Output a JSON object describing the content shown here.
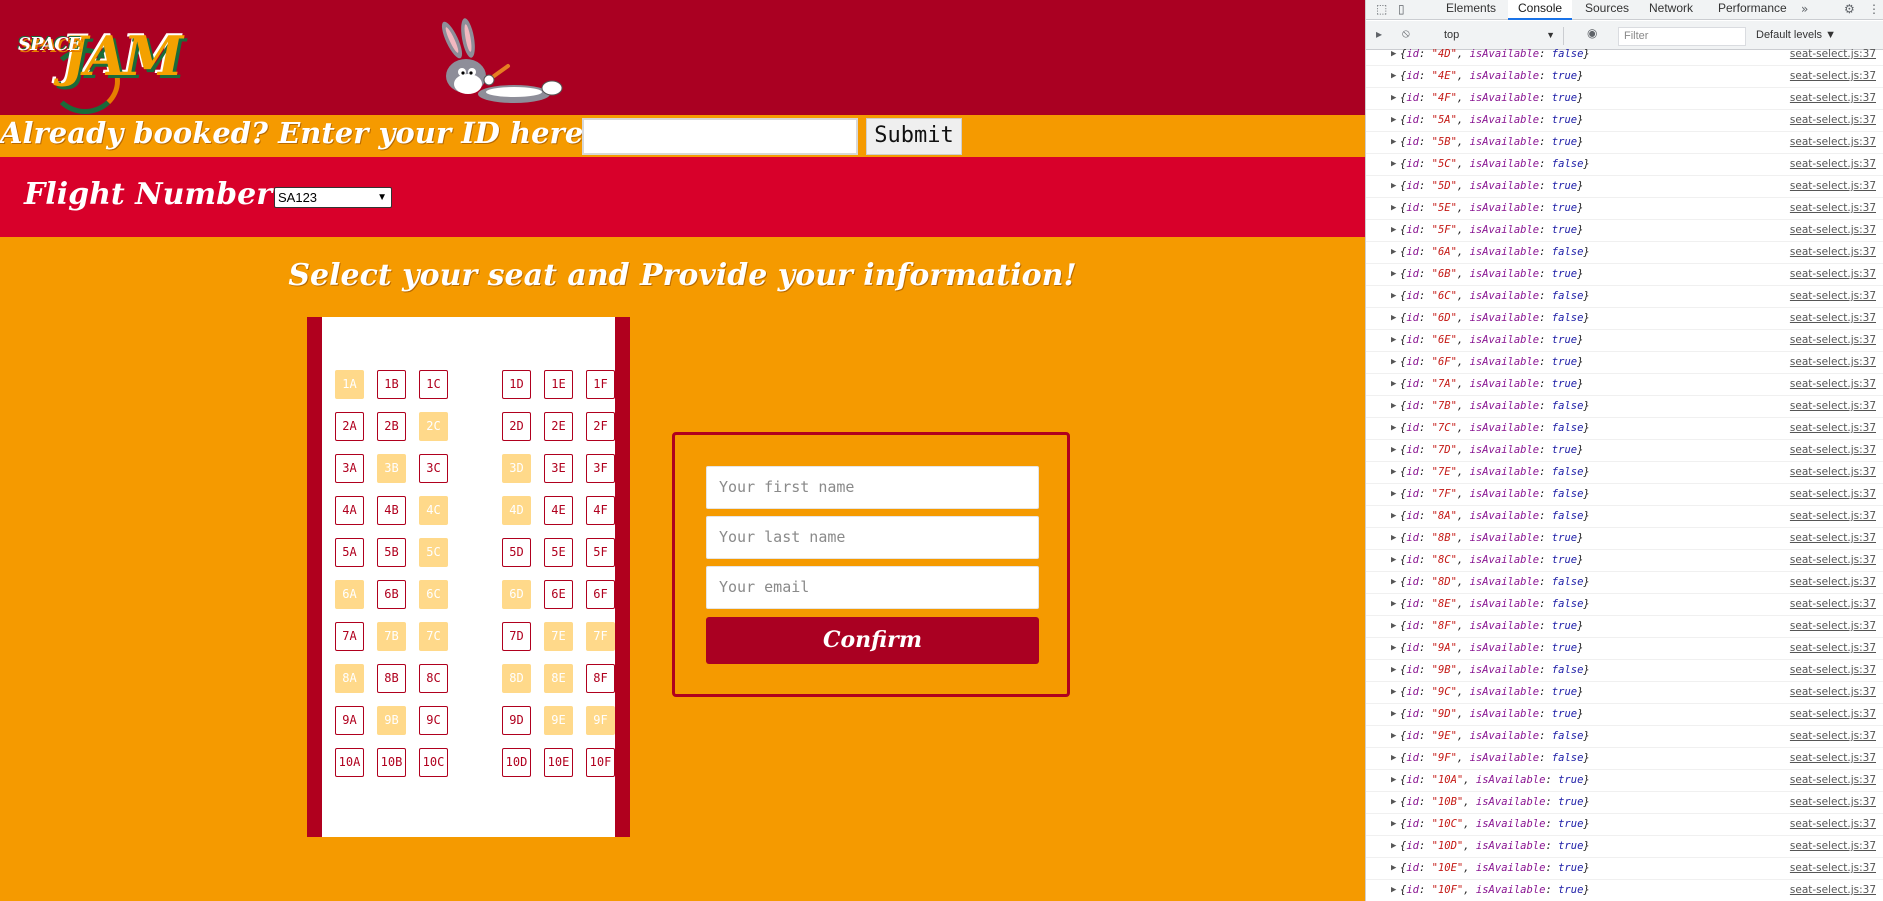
{
  "app": {
    "logo_text_space": "SPACE",
    "logo_text_jam": "JAM",
    "booked_label": "Already booked? Enter your ID here!",
    "booked_input_value": "",
    "submit_label": "Submit",
    "flight_label": "Flight Number :",
    "flight_selected": "SA123",
    "title": "Select your seat and Provide your information!",
    "seats_left": [
      [
        {
          "id": "1A",
          "taken": true
        },
        {
          "id": "1B",
          "taken": false
        },
        {
          "id": "1C",
          "taken": false
        }
      ],
      [
        {
          "id": "2A",
          "taken": false
        },
        {
          "id": "2B",
          "taken": false
        },
        {
          "id": "2C",
          "taken": true
        }
      ],
      [
        {
          "id": "3A",
          "taken": false
        },
        {
          "id": "3B",
          "taken": true
        },
        {
          "id": "3C",
          "taken": false
        }
      ],
      [
        {
          "id": "4A",
          "taken": false
        },
        {
          "id": "4B",
          "taken": false
        },
        {
          "id": "4C",
          "taken": true
        }
      ],
      [
        {
          "id": "5A",
          "taken": false
        },
        {
          "id": "5B",
          "taken": false
        },
        {
          "id": "5C",
          "taken": true
        }
      ],
      [
        {
          "id": "6A",
          "taken": true
        },
        {
          "id": "6B",
          "taken": false
        },
        {
          "id": "6C",
          "taken": true
        }
      ],
      [
        {
          "id": "7A",
          "taken": false
        },
        {
          "id": "7B",
          "taken": true
        },
        {
          "id": "7C",
          "taken": true
        }
      ],
      [
        {
          "id": "8A",
          "taken": true
        },
        {
          "id": "8B",
          "taken": false
        },
        {
          "id": "8C",
          "taken": false
        }
      ],
      [
        {
          "id": "9A",
          "taken": false
        },
        {
          "id": "9B",
          "taken": true
        },
        {
          "id": "9C",
          "taken": false
        }
      ],
      [
        {
          "id": "10A",
          "taken": false
        },
        {
          "id": "10B",
          "taken": false
        },
        {
          "id": "10C",
          "taken": false
        }
      ]
    ],
    "seats_right": [
      [
        {
          "id": "1D",
          "taken": false
        },
        {
          "id": "1E",
          "taken": false
        },
        {
          "id": "1F",
          "taken": false
        }
      ],
      [
        {
          "id": "2D",
          "taken": false
        },
        {
          "id": "2E",
          "taken": false
        },
        {
          "id": "2F",
          "taken": false
        }
      ],
      [
        {
          "id": "3D",
          "taken": true
        },
        {
          "id": "3E",
          "taken": false
        },
        {
          "id": "3F",
          "taken": false
        }
      ],
      [
        {
          "id": "4D",
          "taken": true
        },
        {
          "id": "4E",
          "taken": false
        },
        {
          "id": "4F",
          "taken": false
        }
      ],
      [
        {
          "id": "5D",
          "taken": false
        },
        {
          "id": "5E",
          "taken": false
        },
        {
          "id": "5F",
          "taken": false
        }
      ],
      [
        {
          "id": "6D",
          "taken": true
        },
        {
          "id": "6E",
          "taken": false
        },
        {
          "id": "6F",
          "taken": false
        }
      ],
      [
        {
          "id": "7D",
          "taken": false
        },
        {
          "id": "7E",
          "taken": true
        },
        {
          "id": "7F",
          "taken": true
        }
      ],
      [
        {
          "id": "8D",
          "taken": true
        },
        {
          "id": "8E",
          "taken": true
        },
        {
          "id": "8F",
          "taken": false
        }
      ],
      [
        {
          "id": "9D",
          "taken": false
        },
        {
          "id": "9E",
          "taken": true
        },
        {
          "id": "9F",
          "taken": true
        }
      ],
      [
        {
          "id": "10D",
          "taken": false
        },
        {
          "id": "10E",
          "taken": false
        },
        {
          "id": "10F",
          "taken": false
        }
      ]
    ],
    "form": {
      "first_name_placeholder": "Your first name",
      "last_name_placeholder": "Your last name",
      "email_placeholder": "Your email",
      "confirm_label": "Confirm"
    },
    "colors": {
      "header_red": "#aa0022",
      "flight_red": "#d8002a",
      "orange": "#f59a00",
      "seat_taken": "#ffd98a"
    }
  },
  "devtools": {
    "tabs": [
      "Elements",
      "Console",
      "Sources",
      "Network",
      "Performance"
    ],
    "active_tab": "Console",
    "context": "top",
    "filter_placeholder": "Filter",
    "levels_label": "Default levels",
    "logs": [
      {
        "id": "4D",
        "available": "false"
      },
      {
        "id": "4E",
        "available": "true"
      },
      {
        "id": "4F",
        "available": "true"
      },
      {
        "id": "5A",
        "available": "true"
      },
      {
        "id": "5B",
        "available": "true"
      },
      {
        "id": "5C",
        "available": "false"
      },
      {
        "id": "5D",
        "available": "true"
      },
      {
        "id": "5E",
        "available": "true"
      },
      {
        "id": "5F",
        "available": "true"
      },
      {
        "id": "6A",
        "available": "false"
      },
      {
        "id": "6B",
        "available": "true"
      },
      {
        "id": "6C",
        "available": "false"
      },
      {
        "id": "6D",
        "available": "false"
      },
      {
        "id": "6E",
        "available": "true"
      },
      {
        "id": "6F",
        "available": "true"
      },
      {
        "id": "7A",
        "available": "true"
      },
      {
        "id": "7B",
        "available": "false"
      },
      {
        "id": "7C",
        "available": "false"
      },
      {
        "id": "7D",
        "available": "true"
      },
      {
        "id": "7E",
        "available": "false"
      },
      {
        "id": "7F",
        "available": "false"
      },
      {
        "id": "8A",
        "available": "false"
      },
      {
        "id": "8B",
        "available": "true"
      },
      {
        "id": "8C",
        "available": "true"
      },
      {
        "id": "8D",
        "available": "false"
      },
      {
        "id": "8E",
        "available": "false"
      },
      {
        "id": "8F",
        "available": "true"
      },
      {
        "id": "9A",
        "available": "true"
      },
      {
        "id": "9B",
        "available": "false"
      },
      {
        "id": "9C",
        "available": "true"
      },
      {
        "id": "9D",
        "available": "true"
      },
      {
        "id": "9E",
        "available": "false"
      },
      {
        "id": "9F",
        "available": "false"
      },
      {
        "id": "10A",
        "available": "true"
      },
      {
        "id": "10B",
        "available": "true"
      },
      {
        "id": "10C",
        "available": "true"
      },
      {
        "id": "10D",
        "available": "true"
      },
      {
        "id": "10E",
        "available": "true"
      },
      {
        "id": "10F",
        "available": "true"
      }
    ],
    "log_source": "seat-select.js:37"
  }
}
